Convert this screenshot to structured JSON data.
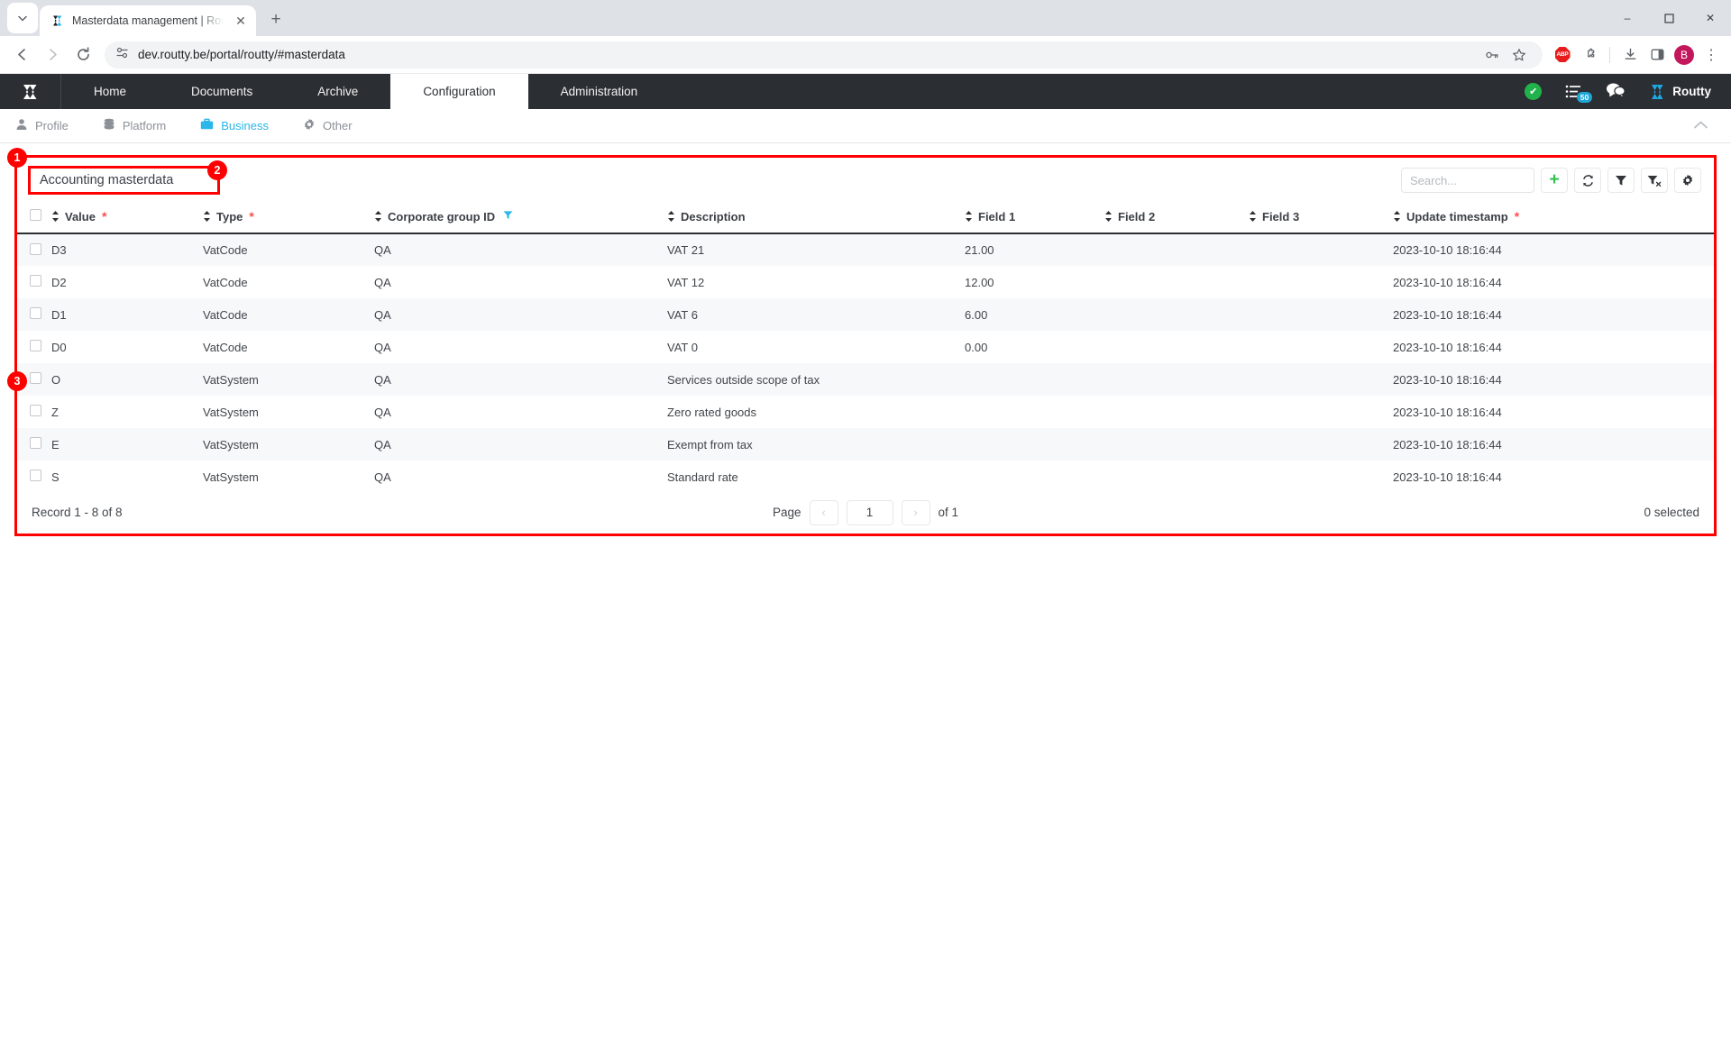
{
  "browser": {
    "tab": {
      "title": "Masterdata management | Rout",
      "favicon": "routty-logo-icon",
      "close": "✕"
    },
    "newtab_label": "+",
    "tablist_chevron": "⌄",
    "nav": {
      "back": "←",
      "forward": "→",
      "reload": "↻"
    },
    "omnibox": {
      "url": "dev.routty.be/portal/routty/#masterdata",
      "site_icon": "site-settings-icon"
    },
    "actions": {
      "password": "password-key-icon",
      "bookmark": "☆",
      "abp": "ABP",
      "extensions": "extensions-puzzle-icon",
      "downloads": "download-icon",
      "sidepanel": "side-panel-icon",
      "avatar": "B",
      "menu": "⋮"
    },
    "window": {
      "minimize": "–",
      "maximize": "❐",
      "close": "✕"
    }
  },
  "mainnav": {
    "brand": "routty-logo-icon",
    "items": [
      {
        "label": "Home",
        "active": false
      },
      {
        "label": "Documents",
        "active": false
      },
      {
        "label": "Archive",
        "active": false
      },
      {
        "label": "Configuration",
        "active": true
      },
      {
        "label": "Administration",
        "active": false
      }
    ],
    "status_ok": "✔",
    "tasks_badge": "50",
    "chat_icon": "chat-bubbles-icon",
    "user": "Routty"
  },
  "subnav": {
    "items": [
      {
        "label": "Profile",
        "icon": "person-icon",
        "active": false
      },
      {
        "label": "Platform",
        "icon": "database-icon",
        "active": false
      },
      {
        "label": "Business",
        "icon": "briefcase-icon",
        "active": true
      },
      {
        "label": "Other",
        "icon": "gear-icon",
        "active": false
      }
    ],
    "collapse": "chevron-up-icon"
  },
  "panel": {
    "title": "Accounting masterdata",
    "search_placeholder": "Search...",
    "tools": {
      "add": "+",
      "refresh": "refresh-icon",
      "filter": "filter-icon",
      "clear_filter": "clear-filter-icon",
      "settings": "gear-icon"
    },
    "annotations": [
      {
        "id": "badge1",
        "label": "1"
      },
      {
        "id": "badge2",
        "label": "2"
      },
      {
        "id": "badge3",
        "label": "3"
      }
    ]
  },
  "table": {
    "columns": [
      {
        "label": "Value",
        "required": true,
        "filtered": false,
        "sortable": true
      },
      {
        "label": "Type",
        "required": true,
        "filtered": false,
        "sortable": true
      },
      {
        "label": "Corporate group ID",
        "required": false,
        "filtered": true,
        "sortable": true
      },
      {
        "label": "Description",
        "required": false,
        "filtered": false,
        "sortable": true
      },
      {
        "label": "Field 1",
        "required": false,
        "filtered": false,
        "sortable": true
      },
      {
        "label": "Field 2",
        "required": false,
        "filtered": false,
        "sortable": true
      },
      {
        "label": "Field 3",
        "required": false,
        "filtered": false,
        "sortable": true
      },
      {
        "label": "Update timestamp",
        "required": true,
        "filtered": false,
        "sortable": true
      }
    ],
    "rows": [
      {
        "value": "D3",
        "type": "VatCode",
        "group": "QA",
        "description": "VAT 21",
        "f1": "21.00",
        "f2": "",
        "f3": "",
        "ts": "2023-10-10 18:16:44"
      },
      {
        "value": "D2",
        "type": "VatCode",
        "group": "QA",
        "description": "VAT 12",
        "f1": "12.00",
        "f2": "",
        "f3": "",
        "ts": "2023-10-10 18:16:44"
      },
      {
        "value": "D1",
        "type": "VatCode",
        "group": "QA",
        "description": "VAT 6",
        "f1": "6.00",
        "f2": "",
        "f3": "",
        "ts": "2023-10-10 18:16:44"
      },
      {
        "value": "D0",
        "type": "VatCode",
        "group": "QA",
        "description": "VAT 0",
        "f1": "0.00",
        "f2": "",
        "f3": "",
        "ts": "2023-10-10 18:16:44"
      },
      {
        "value": "O",
        "type": "VatSystem",
        "group": "QA",
        "description": "Services outside scope of tax",
        "f1": "",
        "f2": "",
        "f3": "",
        "ts": "2023-10-10 18:16:44"
      },
      {
        "value": "Z",
        "type": "VatSystem",
        "group": "QA",
        "description": "Zero rated goods",
        "f1": "",
        "f2": "",
        "f3": "",
        "ts": "2023-10-10 18:16:44"
      },
      {
        "value": "E",
        "type": "VatSystem",
        "group": "QA",
        "description": "Exempt from tax",
        "f1": "",
        "f2": "",
        "f3": "",
        "ts": "2023-10-10 18:16:44"
      },
      {
        "value": "S",
        "type": "VatSystem",
        "group": "QA",
        "description": "Standard rate",
        "f1": "",
        "f2": "",
        "f3": "",
        "ts": "2023-10-10 18:16:44"
      }
    ]
  },
  "footer": {
    "record_range": "Record 1 - 8 of 8",
    "page_label": "Page",
    "page_value": "1",
    "of_label": "of 1",
    "prev": "‹",
    "next": "›",
    "selected": "0 selected"
  },
  "colors": {
    "nav_bg": "#2b2e33",
    "accent_cyan": "#29b6e8",
    "add_green": "#2fc04f",
    "status_green": "#22b24c",
    "annotation_red": "#ff0000",
    "required_red": "#ff4d4d"
  }
}
